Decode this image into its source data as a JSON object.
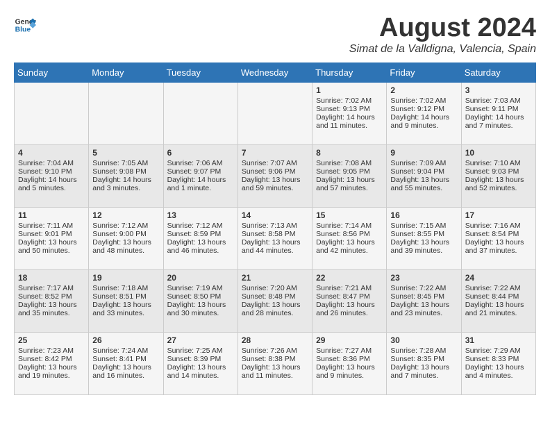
{
  "logo": {
    "line1": "General",
    "line2": "Blue"
  },
  "title": "August 2024",
  "subtitle": "Simat de la Valldigna, Valencia, Spain",
  "days_of_week": [
    "Sunday",
    "Monday",
    "Tuesday",
    "Wednesday",
    "Thursday",
    "Friday",
    "Saturday"
  ],
  "weeks": [
    [
      {
        "day": "",
        "content": ""
      },
      {
        "day": "",
        "content": ""
      },
      {
        "day": "",
        "content": ""
      },
      {
        "day": "",
        "content": ""
      },
      {
        "day": "1",
        "content": "Sunrise: 7:02 AM\nSunset: 9:13 PM\nDaylight: 14 hours\nand 11 minutes."
      },
      {
        "day": "2",
        "content": "Sunrise: 7:02 AM\nSunset: 9:12 PM\nDaylight: 14 hours\nand 9 minutes."
      },
      {
        "day": "3",
        "content": "Sunrise: 7:03 AM\nSunset: 9:11 PM\nDaylight: 14 hours\nand 7 minutes."
      }
    ],
    [
      {
        "day": "4",
        "content": "Sunrise: 7:04 AM\nSunset: 9:10 PM\nDaylight: 14 hours\nand 5 minutes."
      },
      {
        "day": "5",
        "content": "Sunrise: 7:05 AM\nSunset: 9:08 PM\nDaylight: 14 hours\nand 3 minutes."
      },
      {
        "day": "6",
        "content": "Sunrise: 7:06 AM\nSunset: 9:07 PM\nDaylight: 14 hours\nand 1 minute."
      },
      {
        "day": "7",
        "content": "Sunrise: 7:07 AM\nSunset: 9:06 PM\nDaylight: 13 hours\nand 59 minutes."
      },
      {
        "day": "8",
        "content": "Sunrise: 7:08 AM\nSunset: 9:05 PM\nDaylight: 13 hours\nand 57 minutes."
      },
      {
        "day": "9",
        "content": "Sunrise: 7:09 AM\nSunset: 9:04 PM\nDaylight: 13 hours\nand 55 minutes."
      },
      {
        "day": "10",
        "content": "Sunrise: 7:10 AM\nSunset: 9:03 PM\nDaylight: 13 hours\nand 52 minutes."
      }
    ],
    [
      {
        "day": "11",
        "content": "Sunrise: 7:11 AM\nSunset: 9:01 PM\nDaylight: 13 hours\nand 50 minutes."
      },
      {
        "day": "12",
        "content": "Sunrise: 7:12 AM\nSunset: 9:00 PM\nDaylight: 13 hours\nand 48 minutes."
      },
      {
        "day": "13",
        "content": "Sunrise: 7:12 AM\nSunset: 8:59 PM\nDaylight: 13 hours\nand 46 minutes."
      },
      {
        "day": "14",
        "content": "Sunrise: 7:13 AM\nSunset: 8:58 PM\nDaylight: 13 hours\nand 44 minutes."
      },
      {
        "day": "15",
        "content": "Sunrise: 7:14 AM\nSunset: 8:56 PM\nDaylight: 13 hours\nand 42 minutes."
      },
      {
        "day": "16",
        "content": "Sunrise: 7:15 AM\nSunset: 8:55 PM\nDaylight: 13 hours\nand 39 minutes."
      },
      {
        "day": "17",
        "content": "Sunrise: 7:16 AM\nSunset: 8:54 PM\nDaylight: 13 hours\nand 37 minutes."
      }
    ],
    [
      {
        "day": "18",
        "content": "Sunrise: 7:17 AM\nSunset: 8:52 PM\nDaylight: 13 hours\nand 35 minutes."
      },
      {
        "day": "19",
        "content": "Sunrise: 7:18 AM\nSunset: 8:51 PM\nDaylight: 13 hours\nand 33 minutes."
      },
      {
        "day": "20",
        "content": "Sunrise: 7:19 AM\nSunset: 8:50 PM\nDaylight: 13 hours\nand 30 minutes."
      },
      {
        "day": "21",
        "content": "Sunrise: 7:20 AM\nSunset: 8:48 PM\nDaylight: 13 hours\nand 28 minutes."
      },
      {
        "day": "22",
        "content": "Sunrise: 7:21 AM\nSunset: 8:47 PM\nDaylight: 13 hours\nand 26 minutes."
      },
      {
        "day": "23",
        "content": "Sunrise: 7:22 AM\nSunset: 8:45 PM\nDaylight: 13 hours\nand 23 minutes."
      },
      {
        "day": "24",
        "content": "Sunrise: 7:22 AM\nSunset: 8:44 PM\nDaylight: 13 hours\nand 21 minutes."
      }
    ],
    [
      {
        "day": "25",
        "content": "Sunrise: 7:23 AM\nSunset: 8:42 PM\nDaylight: 13 hours\nand 19 minutes."
      },
      {
        "day": "26",
        "content": "Sunrise: 7:24 AM\nSunset: 8:41 PM\nDaylight: 13 hours\nand 16 minutes."
      },
      {
        "day": "27",
        "content": "Sunrise: 7:25 AM\nSunset: 8:39 PM\nDaylight: 13 hours\nand 14 minutes."
      },
      {
        "day": "28",
        "content": "Sunrise: 7:26 AM\nSunset: 8:38 PM\nDaylight: 13 hours\nand 11 minutes."
      },
      {
        "day": "29",
        "content": "Sunrise: 7:27 AM\nSunset: 8:36 PM\nDaylight: 13 hours\nand 9 minutes."
      },
      {
        "day": "30",
        "content": "Sunrise: 7:28 AM\nSunset: 8:35 PM\nDaylight: 13 hours\nand 7 minutes."
      },
      {
        "day": "31",
        "content": "Sunrise: 7:29 AM\nSunset: 8:33 PM\nDaylight: 13 hours\nand 4 minutes."
      }
    ]
  ]
}
